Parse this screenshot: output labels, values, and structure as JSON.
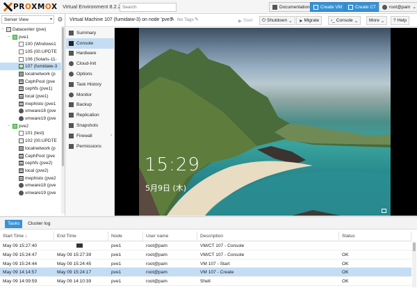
{
  "header": {
    "brand": "PROXMOX",
    "version": "Virtual Environment 8.2.2",
    "search_placeholder": "Search",
    "documentation": "Documentation",
    "create_vm": "Create VM",
    "create_ct": "Create CT",
    "user": "root@pam"
  },
  "tree": {
    "view": "Server View",
    "items": [
      {
        "label": "Datacenter (pve)"
      },
      {
        "label": "pve1"
      },
      {
        "label": "100 (Windows1"
      },
      {
        "label": "105 (00.UPDTE"
      },
      {
        "label": "106 (Solaris-11-"
      },
      {
        "label": "107 (fumidaiw-3"
      },
      {
        "label": "localnetwork (p"
      },
      {
        "label": "CephPool (pve"
      },
      {
        "label": "cephfs (pve1)"
      },
      {
        "label": "local (pve1)"
      },
      {
        "label": "mephisto (pve1"
      },
      {
        "label": "vmware18 (pve"
      },
      {
        "label": "vmware19 (pve"
      },
      {
        "label": "pve2"
      },
      {
        "label": "101 (test)"
      },
      {
        "label": "102 (00.UPDTE"
      },
      {
        "label": "localnetwork (p"
      },
      {
        "label": "CephPool (pve"
      },
      {
        "label": "cephfs (pve2)"
      },
      {
        "label": "local (pve2)"
      },
      {
        "label": "mephisto (pve2"
      },
      {
        "label": "vmware18 (pve"
      },
      {
        "label": "vmware19 (pve"
      }
    ]
  },
  "toolbar": {
    "title": "Virtual Machine 107 (fumidaiw-3) on node 'pve1'",
    "tags": "No Tags",
    "start": "Start",
    "shutdown": "Shutdown",
    "migrate": "Migrate",
    "console": "Console",
    "more": "More",
    "help": "Help"
  },
  "menu": {
    "items": [
      {
        "label": "Summary"
      },
      {
        "label": "Console"
      },
      {
        "label": "Hardware"
      },
      {
        "label": "Cloud-Init"
      },
      {
        "label": "Options"
      },
      {
        "label": "Task History"
      },
      {
        "label": "Monitor"
      },
      {
        "label": "Backup"
      },
      {
        "label": "Replication"
      },
      {
        "label": "Snapshots"
      },
      {
        "label": "Firewall"
      },
      {
        "label": "Permissions"
      }
    ]
  },
  "console_screen": {
    "time": "15:29",
    "date": "5月9日 (木)"
  },
  "bottom": {
    "tabs": [
      "Tasks",
      "Cluster log"
    ],
    "columns": [
      "Start Time ↓",
      "End Time",
      "Node",
      "User name",
      "Description",
      "Status"
    ],
    "rows": [
      {
        "start": "May 09 15:27:40",
        "end": "",
        "node": "pve1",
        "user": "root@pam",
        "desc": "VM/CT 107 - Console",
        "status": ""
      },
      {
        "start": "May 09 15:24:47",
        "end": "May 09 15:27:39",
        "node": "pve1",
        "user": "root@pam",
        "desc": "VM/CT 107 - Console",
        "status": "OK"
      },
      {
        "start": "May 09 15:24:44",
        "end": "May 09 15:24:45",
        "node": "pve1",
        "user": "root@pam",
        "desc": "VM 107 - Start",
        "status": "OK"
      },
      {
        "start": "May 09 14:14:57",
        "end": "May 09 15:24:17",
        "node": "pve1",
        "user": "root@pam",
        "desc": "VM 107 - Create",
        "status": "OK"
      },
      {
        "start": "May 09 14:09:59",
        "end": "May 09 14:10:39",
        "node": "pve1",
        "user": "root@pam",
        "desc": "Shell",
        "status": "OK"
      }
    ]
  },
  "colors": {
    "accent": "#3892d4",
    "brand_orange": "#e57000",
    "selection": "#c3ddf4"
  }
}
